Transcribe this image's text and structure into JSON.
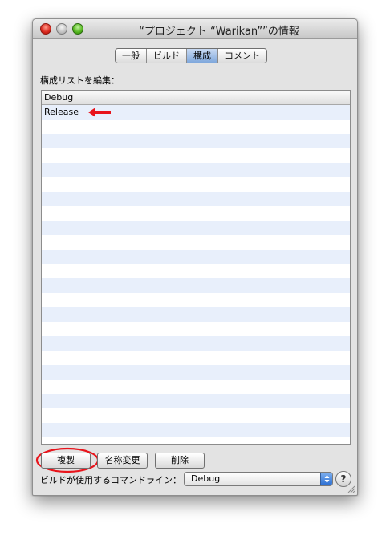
{
  "window": {
    "title": "“プロジェクト “Warikan””の情報"
  },
  "tabs": [
    {
      "label": "一般"
    },
    {
      "label": "ビルド"
    },
    {
      "label": "構成",
      "selected": true
    },
    {
      "label": "コメント"
    }
  ],
  "config_list": {
    "label": "構成リストを編集：",
    "header": "Debug",
    "items": [
      "Release"
    ]
  },
  "buttons": {
    "duplicate": "複製",
    "rename": "名称変更",
    "delete": "削除"
  },
  "command_line": {
    "label": "ビルドが使用するコマンドライン：",
    "selected": "Debug"
  },
  "help": {
    "glyph": "?"
  },
  "colors": {
    "annotation_red": "#e8141b",
    "row_stripe": "#e8effb",
    "selected_tab": "#7fa7dc"
  },
  "icons": [
    "close-button",
    "minimize-button",
    "zoom-button",
    "red-arrow-annotation",
    "popup-arrows-icon",
    "help-icon",
    "resize-grip-icon"
  ]
}
